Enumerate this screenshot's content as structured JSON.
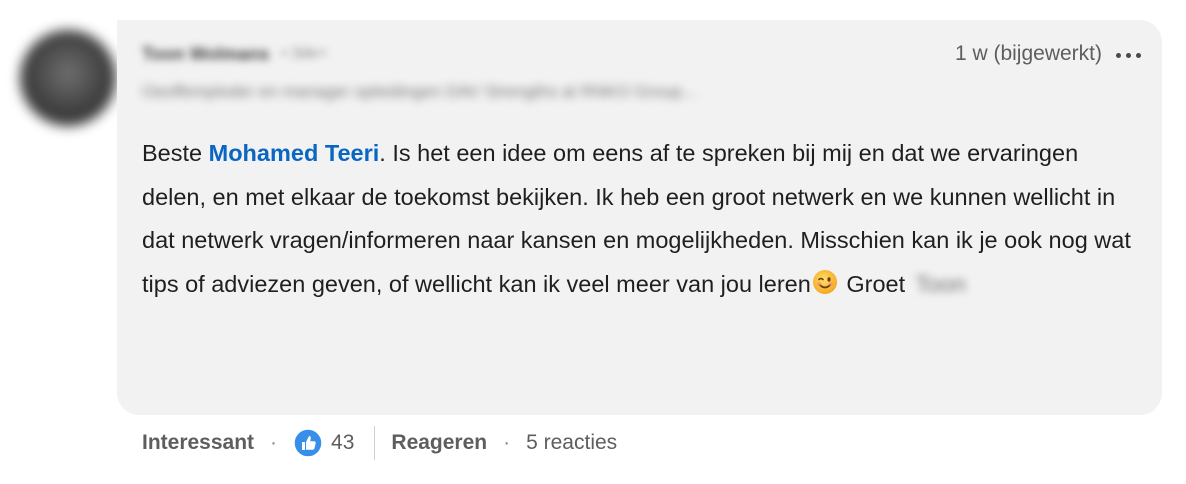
{
  "author": {
    "name": "Toon Wolmans",
    "degree": "• 3de+",
    "headline": "Oeoffemploder en manager opleidingen DAV Strengths at RNKO Group..."
  },
  "comment": {
    "meta": "1 w (bijgewerkt)",
    "more_icon": "more-horizontal-icon",
    "text_before_mention": "Beste ",
    "mention": "Mohamed Teeri",
    "text_after_mention": ". Is het een idee om eens af te spreken bij mij en dat we ervaringen delen, en met elkaar de toekomst bekijken. Ik heb een groot netwerk en we kunnen wellicht in dat netwerk vragen/informeren naar kansen en mogelijkheden. Misschien kan ik je ook nog wat tips of adviezen geven, of wellicht kan ik veel meer van jou leren",
    "emoji": "winking-face-emoji",
    "sign_off": " Groet",
    "sign_off_name": "Toon"
  },
  "actions": {
    "react_label": "Interessant",
    "separator": "·",
    "reaction_icon": "like-thumb-icon",
    "reaction_count": "43",
    "reply_label": "Reageren",
    "replies_count": "5 reacties"
  },
  "colors": {
    "mention": "#0a66c2",
    "bubble_bg": "#f2f2f2",
    "reaction_blue": "#378fe9"
  }
}
